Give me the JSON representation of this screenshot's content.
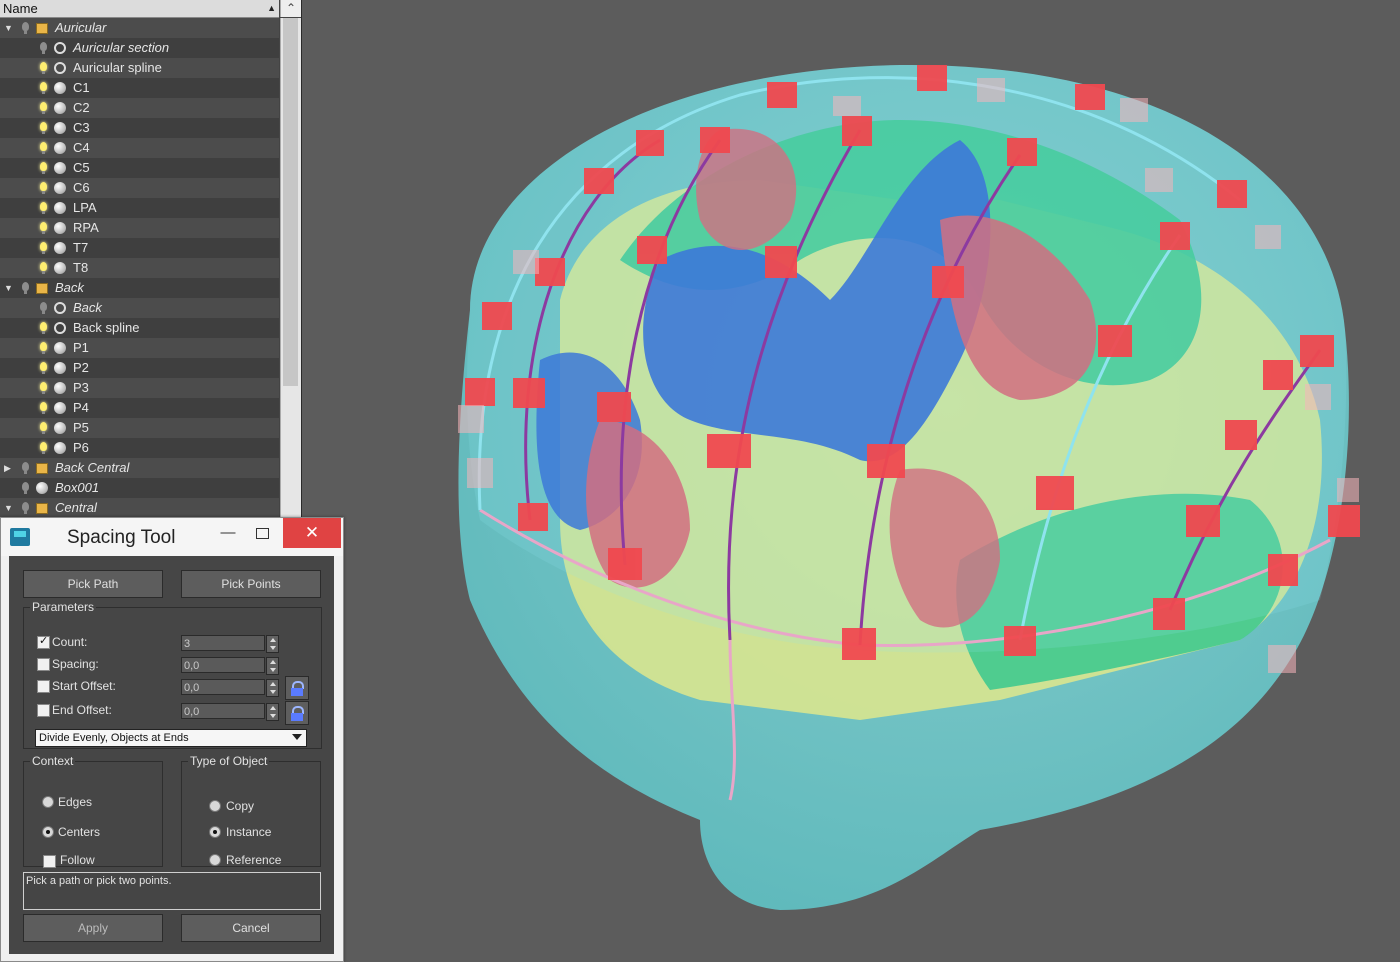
{
  "explorer": {
    "column_header": "Name",
    "rows": [
      {
        "label": "Auricular",
        "indent": 0,
        "expand": "open",
        "bulb": "off",
        "icon": "layer",
        "italic": true
      },
      {
        "label": "Auricular section",
        "indent": 1,
        "bulb": "off",
        "icon": "shape",
        "italic": true
      },
      {
        "label": "Auricular spline",
        "indent": 1,
        "bulb": "on",
        "icon": "shape",
        "italic": false
      },
      {
        "label": "C1",
        "indent": 1,
        "bulb": "on",
        "icon": "sphere",
        "italic": false
      },
      {
        "label": "C2",
        "indent": 1,
        "bulb": "on",
        "icon": "sphere",
        "italic": false
      },
      {
        "label": "C3",
        "indent": 1,
        "bulb": "on",
        "icon": "sphere",
        "italic": false
      },
      {
        "label": "C4",
        "indent": 1,
        "bulb": "on",
        "icon": "sphere",
        "italic": false
      },
      {
        "label": "C5",
        "indent": 1,
        "bulb": "on",
        "icon": "sphere",
        "italic": false
      },
      {
        "label": "C6",
        "indent": 1,
        "bulb": "on",
        "icon": "sphere",
        "italic": false
      },
      {
        "label": "LPA",
        "indent": 1,
        "bulb": "on",
        "icon": "sphere",
        "italic": false
      },
      {
        "label": "RPA",
        "indent": 1,
        "bulb": "on",
        "icon": "sphere",
        "italic": false
      },
      {
        "label": "T7",
        "indent": 1,
        "bulb": "on",
        "icon": "sphere",
        "italic": false
      },
      {
        "label": "T8",
        "indent": 1,
        "bulb": "on",
        "icon": "sphere",
        "italic": false
      },
      {
        "label": "Back",
        "indent": 0,
        "expand": "open",
        "bulb": "off",
        "icon": "layer",
        "italic": true
      },
      {
        "label": "Back",
        "indent": 1,
        "bulb": "off",
        "icon": "shape",
        "italic": true
      },
      {
        "label": "Back spline",
        "indent": 1,
        "bulb": "on",
        "icon": "shape",
        "italic": false
      },
      {
        "label": "P1",
        "indent": 1,
        "bulb": "on",
        "icon": "sphere",
        "italic": false
      },
      {
        "label": "P2",
        "indent": 1,
        "bulb": "on",
        "icon": "sphere",
        "italic": false
      },
      {
        "label": "P3",
        "indent": 1,
        "bulb": "on",
        "icon": "sphere",
        "italic": false
      },
      {
        "label": "P4",
        "indent": 1,
        "bulb": "on",
        "icon": "sphere",
        "italic": false
      },
      {
        "label": "P5",
        "indent": 1,
        "bulb": "on",
        "icon": "sphere",
        "italic": false
      },
      {
        "label": "P6",
        "indent": 1,
        "bulb": "on",
        "icon": "sphere",
        "italic": false
      },
      {
        "label": "Back Central",
        "indent": 0,
        "expand": "closed",
        "bulb": "off",
        "icon": "layer",
        "italic": true
      },
      {
        "label": "Box001",
        "indent": 0,
        "bulb": "off",
        "icon": "sphere",
        "italic": true
      },
      {
        "label": "Central",
        "indent": 0,
        "expand": "open",
        "bulb": "off",
        "icon": "layer",
        "italic": true
      }
    ]
  },
  "dialog": {
    "title": "Spacing Tool",
    "minimize": "—",
    "close": "✕",
    "pick_path": "Pick Path",
    "pick_points": "Pick Points",
    "parameters": {
      "legend": "Parameters",
      "count_label": "Count:",
      "count_value": "3",
      "count_checked": true,
      "spacing_label": "Spacing:",
      "spacing_value": "0,0",
      "start_offset_label": "Start Offset:",
      "start_offset_value": "0,0",
      "end_offset_label": "End Offset:",
      "end_offset_value": "0,0",
      "mode": "Divide Evenly, Objects at Ends"
    },
    "context": {
      "legend": "Context",
      "edges": "Edges",
      "centers": "Centers",
      "follow": "Follow",
      "selected": "Centers"
    },
    "type_of_object": {
      "legend": "Type of Object",
      "copy": "Copy",
      "instance": "Instance",
      "reference": "Reference",
      "selected": "Instance"
    },
    "status": "Pick a path or pick two points.",
    "apply": "Apply",
    "cancel": "Cancel"
  },
  "colors": {
    "viewport_bg": "#5c5c5c",
    "electrode": "#f0494f",
    "head": "#6fd6d8",
    "region_blue": "#2a62d4",
    "region_green": "#38c88e",
    "region_yellow": "#dfe78c",
    "region_red": "#e0566a",
    "spline_purple": "#8c3aa0",
    "spline_cyan": "#8fe3ee",
    "spline_pink": "#e8a6c8"
  }
}
